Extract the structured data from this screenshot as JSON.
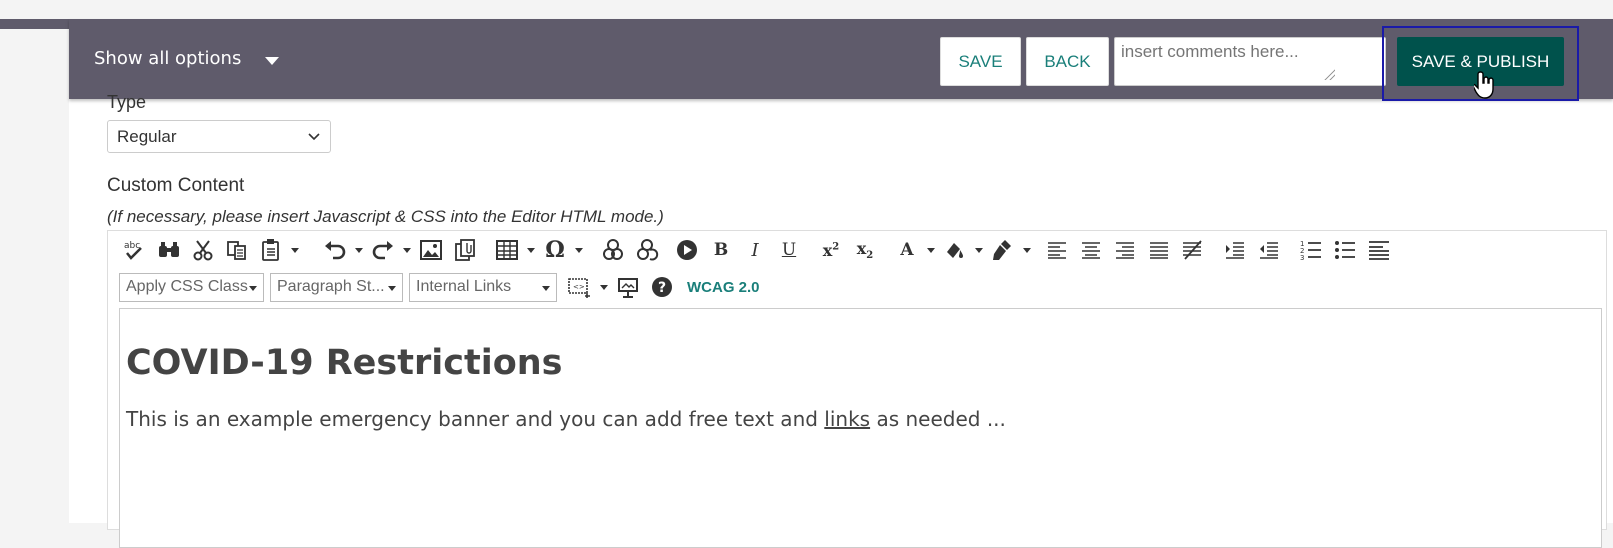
{
  "header": {
    "show_all_label": "Show all options",
    "save_label": "SAVE",
    "back_label": "BACK",
    "comments_placeholder": "insert comments here...",
    "publish_label": "SAVE & PUBLISH"
  },
  "form": {
    "type_label": "Type",
    "type_value": "Regular",
    "custom_content_label": "Custom Content",
    "custom_content_hint": "(If necessary, please insert Javascript & CSS into the Editor HTML mode.)"
  },
  "editor": {
    "toolbar_row2": {
      "css_class": "Apply CSS Class",
      "paragraph_style": "Paragraph St...",
      "internal_links": "Internal Links",
      "wcag_label": "WCAG 2.0"
    },
    "toolbar_icons": [
      "spellcheck-icon",
      "find-icon",
      "cut-icon",
      "copy-icon",
      "paste-icon",
      "undo-icon",
      "redo-icon",
      "image-icon",
      "document-manager-icon",
      "table-icon",
      "special-char-icon",
      "link-icon",
      "unlink-icon",
      "media-icon",
      "bold-icon",
      "italic-icon",
      "underline-icon",
      "superscript-icon",
      "subscript-icon",
      "font-color-icon",
      "highlight-icon",
      "format-stripper-icon",
      "align-left-icon",
      "align-center-icon",
      "align-right-icon",
      "justify-icon",
      "remove-alignment-icon",
      "outdent-icon",
      "indent-icon",
      "numbered-list-icon",
      "bulleted-list-icon",
      "horizontal-rule-icon"
    ],
    "content": {
      "heading": "COVID-19 Restrictions",
      "paragraph_before_link": "This is an example emergency banner and you can add free text and ",
      "link_text": "links",
      "paragraph_after_link": " as needed ..."
    }
  }
}
